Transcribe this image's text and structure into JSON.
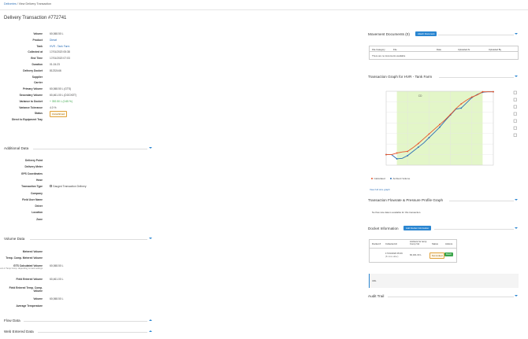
{
  "breadcrumb": {
    "root": "Deliveries",
    "sep": "/",
    "current": "View Delivery Transaction"
  },
  "page": {
    "title": "Delivery Transaction #772741"
  },
  "transaction": [
    {
      "label": "Volume",
      "value": "60,068.50 L"
    },
    {
      "label": "Product",
      "value": "Diesel",
      "link": true
    },
    {
      "label": "Tank",
      "value": "HVR - Tank Farm",
      "link": true
    },
    {
      "label": "Collected at",
      "value": "17/01/2020 05:38"
    },
    {
      "label": "End Time",
      "value": "17/01/2020 07:03"
    },
    {
      "label": "Duration",
      "value": "01:24:23"
    },
    {
      "label": "Delivery Docket",
      "value": "81232446"
    },
    {
      "label": "Supplier",
      "value": ""
    },
    {
      "label": "Carrier",
      "value": ""
    },
    {
      "label": "Primary Volume",
      "value": "60,068.50 L (GTS)"
    },
    {
      "label": "Secondary Volume",
      "value": "60,461.00 L (DOCKET)"
    },
    {
      "label": "Variance to Docket",
      "value": "+ 392.50 L (0.65 %)",
      "green": true
    },
    {
      "label": "Variance Tolerance",
      "value": "4.0 %"
    },
    {
      "label": "Status",
      "value": "Unconfirmed",
      "badge": true
    },
    {
      "label": "Direct to Equipment Tray",
      "value": ""
    }
  ],
  "additional": {
    "title": "Additional Data",
    "rows": [
      {
        "label": "Delivery Point",
        "value": ""
      },
      {
        "label": "Delivery Meter",
        "value": ""
      },
      {
        "label": "GPS Coordinates",
        "value": ""
      },
      {
        "label": "Hose",
        "value": ""
      },
      {
        "label": "Transaction Type",
        "value": "Gauged Transaction Delivery",
        "checkbox": true
      },
      {
        "label": "Company",
        "value": ""
      },
      {
        "label": "Field User Name",
        "value": ""
      },
      {
        "label": "Driver",
        "value": ""
      },
      {
        "label": "Location",
        "value": ""
      },
      {
        "label": "Zone",
        "value": ""
      }
    ]
  },
  "volume": {
    "title": "Volume Data",
    "rows": [
      {
        "label": "Metered Volume",
        "value": ""
      },
      {
        "label": "Temp. Comp. Metered Volume",
        "value": ""
      },
      {
        "label": "GTS Calculated Volume",
        "value": "60,068.50 L",
        "sub": "Ambient or Temp Comp. depending on tank settings"
      },
      {
        "label": "Field Entered Volume",
        "value": "60,461.00 L"
      },
      {
        "label": "Field Entered Temp. Comp. Volume",
        "value": ""
      },
      {
        "label": "Volume",
        "value": "60,068.50 L"
      },
      {
        "label": "Average Temperature",
        "value": ""
      }
    ]
  },
  "flow": {
    "title": "Flow Data"
  },
  "web": {
    "title": "Web Entered Data"
  },
  "movement": {
    "title": "Movement Documents (0)",
    "attach_label": "Attach Document",
    "columns": [
      "File Category",
      "File",
      "Date",
      "Uploaded At",
      "Uploaded By"
    ],
    "empty": "There are no documents available"
  },
  "graph": {
    "title": "Transaction Graph for HVR - Tank Farm",
    "view_link": "View full size graph",
    "legend_calculated": "Calculated",
    "legend_ambient": "Ambient Volume",
    "peak_label": "CD"
  },
  "chart_data": {
    "type": "line",
    "x": [
      0,
      1,
      2,
      3,
      4,
      5,
      6,
      7,
      8,
      9,
      10,
      11,
      12,
      13,
      14,
      15,
      16,
      17,
      18,
      19,
      20
    ],
    "series": [
      {
        "name": "Ambient Volume",
        "color": "#2a6db5",
        "values": [
          6.0,
          6.0,
          5.2,
          5.3,
          5.8,
          6.6,
          7.4,
          8.2,
          9.2,
          10.2,
          11.2,
          12.4,
          13.5,
          14.6,
          14.8,
          15.8,
          16.8,
          17.4,
          17.8,
          17.9,
          17.9
        ]
      },
      {
        "name": "Calculated",
        "color": "#e8542a",
        "values": [
          6.0,
          6.0,
          6.3,
          6.5,
          6.6,
          7.3,
          8.1,
          9.0,
          9.9,
          10.8,
          11.7,
          12.6,
          13.6,
          14.7,
          15.6,
          16.3,
          16.9,
          17.3,
          17.9,
          17.9,
          17.9
        ]
      }
    ],
    "highlight_range": [
      2,
      18
    ],
    "ylim": [
      4,
      18
    ],
    "grid": true,
    "legend": "bottom"
  },
  "flowrate": {
    "title": "Transaction Flowrate & Pressure Profile Graph",
    "empty": "No flow rate data is available for this transaction."
  },
  "docket": {
    "title": "Docket Information",
    "add_label": "Add Docket Information",
    "columns": [
      "Docket #",
      "Collected At",
      "Ambient for temp Comp Vol",
      "Status",
      "Actions"
    ],
    "row": {
      "docket": "81232446",
      "collected": "17/01/2020 05:46",
      "collected_sub": "(8 mins after)",
      "volume": "60,461.00 L",
      "status": "Not Linked",
      "action": "Match"
    },
    "info": "URL"
  },
  "audit": {
    "title": "Audit Trail"
  },
  "colors": {
    "accent": "#2a86d1",
    "success": "#3aa54a",
    "warning": "#e0a23a",
    "chart_fill": "#e3f6c8"
  }
}
